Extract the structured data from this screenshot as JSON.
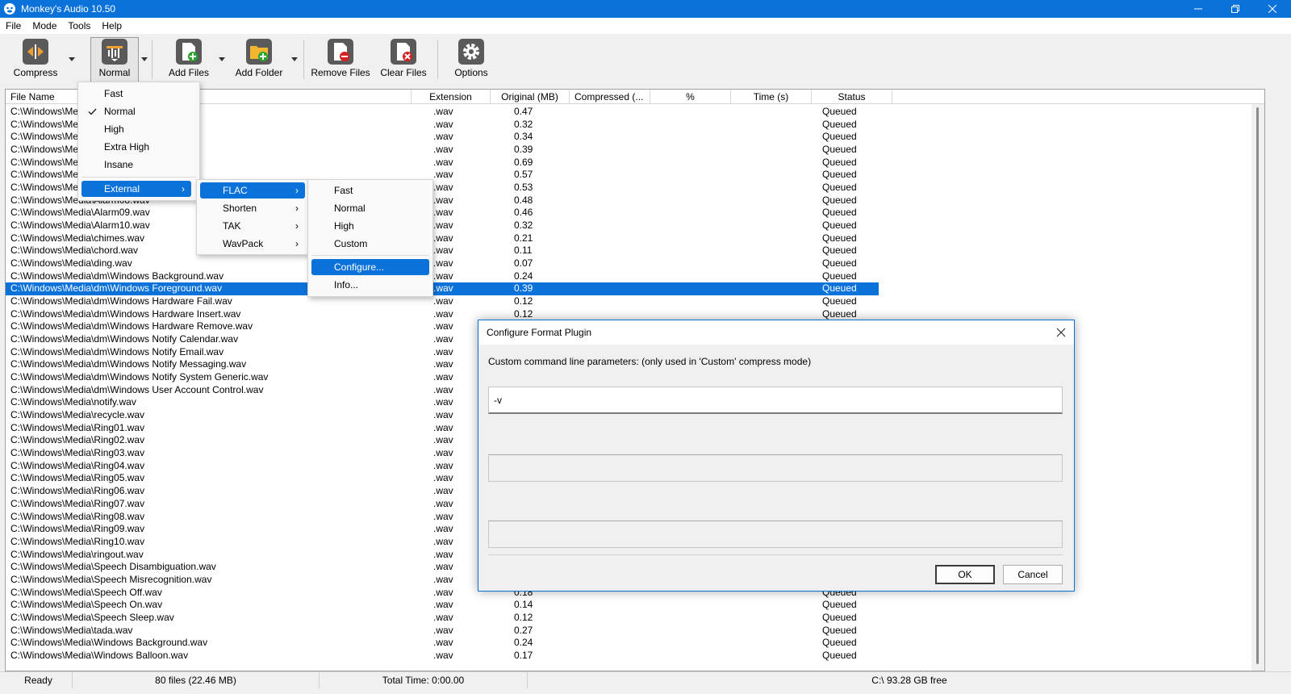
{
  "window": {
    "title": "Monkey's Audio 10.50"
  },
  "menubar": [
    "File",
    "Mode",
    "Tools",
    "Help"
  ],
  "toolbar": {
    "compress": "Compress",
    "normal": "Normal",
    "add_files": "Add Files",
    "add_folder": "Add Folder",
    "remove_files": "Remove Files",
    "clear_files": "Clear Files",
    "options": "Options"
  },
  "columns": [
    "File Name",
    "Extension",
    "Original (MB)",
    "Compressed (...",
    "%",
    "Time (s)",
    "Status"
  ],
  "rows": [
    {
      "file": "C:\\Windows\\Me",
      "ext": ".wav",
      "orig": "0.47",
      "status": "Queued"
    },
    {
      "file": "C:\\Windows\\Me",
      "ext": ".wav",
      "orig": "0.32",
      "status": "Queued"
    },
    {
      "file": "C:\\Windows\\Me",
      "ext": ".wav",
      "orig": "0.34",
      "status": "Queued"
    },
    {
      "file": "C:\\Windows\\Me",
      "ext": ".wav",
      "orig": "0.39",
      "status": "Queued"
    },
    {
      "file": "C:\\Windows\\Me",
      "ext": ".wav",
      "orig": "0.69",
      "status": "Queued"
    },
    {
      "file": "C:\\Windows\\Me",
      "ext": ".wav",
      "orig": "0.57",
      "status": "Queued"
    },
    {
      "file": "C:\\Windows\\Me",
      "ext": ".wav",
      "orig": "0.53",
      "status": "Queued"
    },
    {
      "file": "C:\\Windows\\Media\\Alarm08.wav",
      "ext": ".wav",
      "orig": "0.48",
      "status": "Queued"
    },
    {
      "file": "C:\\Windows\\Media\\Alarm09.wav",
      "ext": ".wav",
      "orig": "0.46",
      "status": "Queued"
    },
    {
      "file": "C:\\Windows\\Media\\Alarm10.wav",
      "ext": ".wav",
      "orig": "0.32",
      "status": "Queued"
    },
    {
      "file": "C:\\Windows\\Media\\chimes.wav",
      "ext": ".wav",
      "orig": "0.21",
      "status": "Queued"
    },
    {
      "file": "C:\\Windows\\Media\\chord.wav",
      "ext": ".wav",
      "orig": "0.11",
      "status": "Queued"
    },
    {
      "file": "C:\\Windows\\Media\\ding.wav",
      "ext": ".wav",
      "orig": "0.07",
      "status": "Queued"
    },
    {
      "file": "C:\\Windows\\Media\\dm\\Windows Background.wav",
      "ext": ".wav",
      "orig": "0.24",
      "status": "Queued"
    },
    {
      "file": "C:\\Windows\\Media\\dm\\Windows Foreground.wav",
      "ext": ".wav",
      "orig": "0.39",
      "status": "Queued",
      "selected": true
    },
    {
      "file": "C:\\Windows\\Media\\dm\\Windows Hardware Fail.wav",
      "ext": ".wav",
      "orig": "0.12",
      "status": "Queued"
    },
    {
      "file": "C:\\Windows\\Media\\dm\\Windows Hardware Insert.wav",
      "ext": ".wav",
      "orig": "0.12",
      "status": "Queued"
    },
    {
      "file": "C:\\Windows\\Media\\dm\\Windows Hardware Remove.wav",
      "ext": ".wav",
      "orig": "",
      "status": ""
    },
    {
      "file": "C:\\Windows\\Media\\dm\\Windows Notify Calendar.wav",
      "ext": ".wav",
      "orig": "",
      "status": ""
    },
    {
      "file": "C:\\Windows\\Media\\dm\\Windows Notify Email.wav",
      "ext": ".wav",
      "orig": "",
      "status": ""
    },
    {
      "file": "C:\\Windows\\Media\\dm\\Windows Notify Messaging.wav",
      "ext": ".wav",
      "orig": "",
      "status": ""
    },
    {
      "file": "C:\\Windows\\Media\\dm\\Windows Notify System Generic.wav",
      "ext": ".wav",
      "orig": "",
      "status": ""
    },
    {
      "file": "C:\\Windows\\Media\\dm\\Windows User Account Control.wav",
      "ext": ".wav",
      "orig": "",
      "status": ""
    },
    {
      "file": "C:\\Windows\\Media\\notify.wav",
      "ext": ".wav",
      "orig": "",
      "status": ""
    },
    {
      "file": "C:\\Windows\\Media\\recycle.wav",
      "ext": ".wav",
      "orig": "",
      "status": ""
    },
    {
      "file": "C:\\Windows\\Media\\Ring01.wav",
      "ext": ".wav",
      "orig": "",
      "status": ""
    },
    {
      "file": "C:\\Windows\\Media\\Ring02.wav",
      "ext": ".wav",
      "orig": "",
      "status": ""
    },
    {
      "file": "C:\\Windows\\Media\\Ring03.wav",
      "ext": ".wav",
      "orig": "",
      "status": ""
    },
    {
      "file": "C:\\Windows\\Media\\Ring04.wav",
      "ext": ".wav",
      "orig": "",
      "status": ""
    },
    {
      "file": "C:\\Windows\\Media\\Ring05.wav",
      "ext": ".wav",
      "orig": "",
      "status": ""
    },
    {
      "file": "C:\\Windows\\Media\\Ring06.wav",
      "ext": ".wav",
      "orig": "",
      "status": ""
    },
    {
      "file": "C:\\Windows\\Media\\Ring07.wav",
      "ext": ".wav",
      "orig": "",
      "status": ""
    },
    {
      "file": "C:\\Windows\\Media\\Ring08.wav",
      "ext": ".wav",
      "orig": "",
      "status": ""
    },
    {
      "file": "C:\\Windows\\Media\\Ring09.wav",
      "ext": ".wav",
      "orig": "",
      "status": ""
    },
    {
      "file": "C:\\Windows\\Media\\Ring10.wav",
      "ext": ".wav",
      "orig": "",
      "status": ""
    },
    {
      "file": "C:\\Windows\\Media\\ringout.wav",
      "ext": ".wav",
      "orig": "",
      "status": ""
    },
    {
      "file": "C:\\Windows\\Media\\Speech Disambiguation.wav",
      "ext": ".wav",
      "orig": "",
      "status": ""
    },
    {
      "file": "C:\\Windows\\Media\\Speech Misrecognition.wav",
      "ext": ".wav",
      "orig": "",
      "status": ""
    },
    {
      "file": "C:\\Windows\\Media\\Speech Off.wav",
      "ext": ".wav",
      "orig": "0.18",
      "status": "Queued"
    },
    {
      "file": "C:\\Windows\\Media\\Speech On.wav",
      "ext": ".wav",
      "orig": "0.14",
      "status": "Queued"
    },
    {
      "file": "C:\\Windows\\Media\\Speech Sleep.wav",
      "ext": ".wav",
      "orig": "0.12",
      "status": "Queued"
    },
    {
      "file": "C:\\Windows\\Media\\tada.wav",
      "ext": ".wav",
      "orig": "0.27",
      "status": "Queued"
    },
    {
      "file": "C:\\Windows\\Media\\Windows Background.wav",
      "ext": ".wav",
      "orig": "0.24",
      "status": "Queued"
    },
    {
      "file": "C:\\Windows\\Media\\Windows Balloon.wav",
      "ext": ".wav",
      "orig": "0.17",
      "status": "Queued"
    }
  ],
  "statusbar": {
    "ready": "Ready",
    "files": "80 files (22.46 MB)",
    "total_time": "Total Time: 0:00.00",
    "free": "C:\\ 93.28 GB free"
  },
  "mode_menu": {
    "items": [
      "Fast",
      "Normal",
      "High",
      "Extra High",
      "Insane"
    ],
    "checked": "Normal",
    "external": "External"
  },
  "external_menu": {
    "items": [
      "FLAC",
      "Shorten",
      "TAK",
      "WavPack"
    ]
  },
  "flac_menu": {
    "items": [
      "Fast",
      "Normal",
      "High",
      "Custom"
    ],
    "configure": "Configure...",
    "info": "Info..."
  },
  "dialog": {
    "title": "Configure Format Plugin",
    "label": "Custom command line parameters: (only used in 'Custom' compress mode)",
    "params_value": "-v",
    "ok": "OK",
    "cancel": "Cancel"
  },
  "colors": {
    "accent": "#0a72d8"
  }
}
